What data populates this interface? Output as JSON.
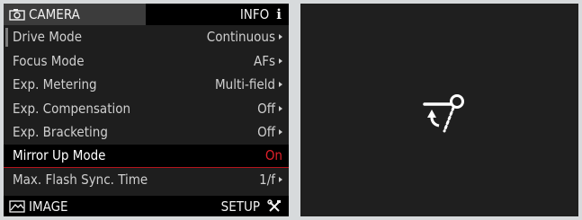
{
  "header": {
    "tab_camera": "CAMERA",
    "tab_info": "INFO",
    "info_icon": "i"
  },
  "menu": [
    {
      "label": "Drive Mode",
      "value": "Continuous"
    },
    {
      "label": "Focus Mode",
      "value": "AFs"
    },
    {
      "label": "Exp. Metering",
      "value": "Multi-field"
    },
    {
      "label": "Exp. Compensation",
      "value": "Off"
    },
    {
      "label": "Exp. Bracketing",
      "value": "Off"
    },
    {
      "label": "Mirror Up Mode",
      "value": "On"
    },
    {
      "label": "Max. Flash Sync. Time",
      "value": "1/f"
    }
  ],
  "footer": {
    "tab_image": "IMAGE",
    "tab_setup": "SETUP"
  },
  "icons": {
    "camera_tab": "camera-icon",
    "info_tab": "info-icon",
    "image_tab": "image-icon",
    "setup_tab": "wrench-screwdriver-icon",
    "detail": "mirror-up-icon"
  },
  "colors": {
    "accent_red": "#e0202a"
  }
}
